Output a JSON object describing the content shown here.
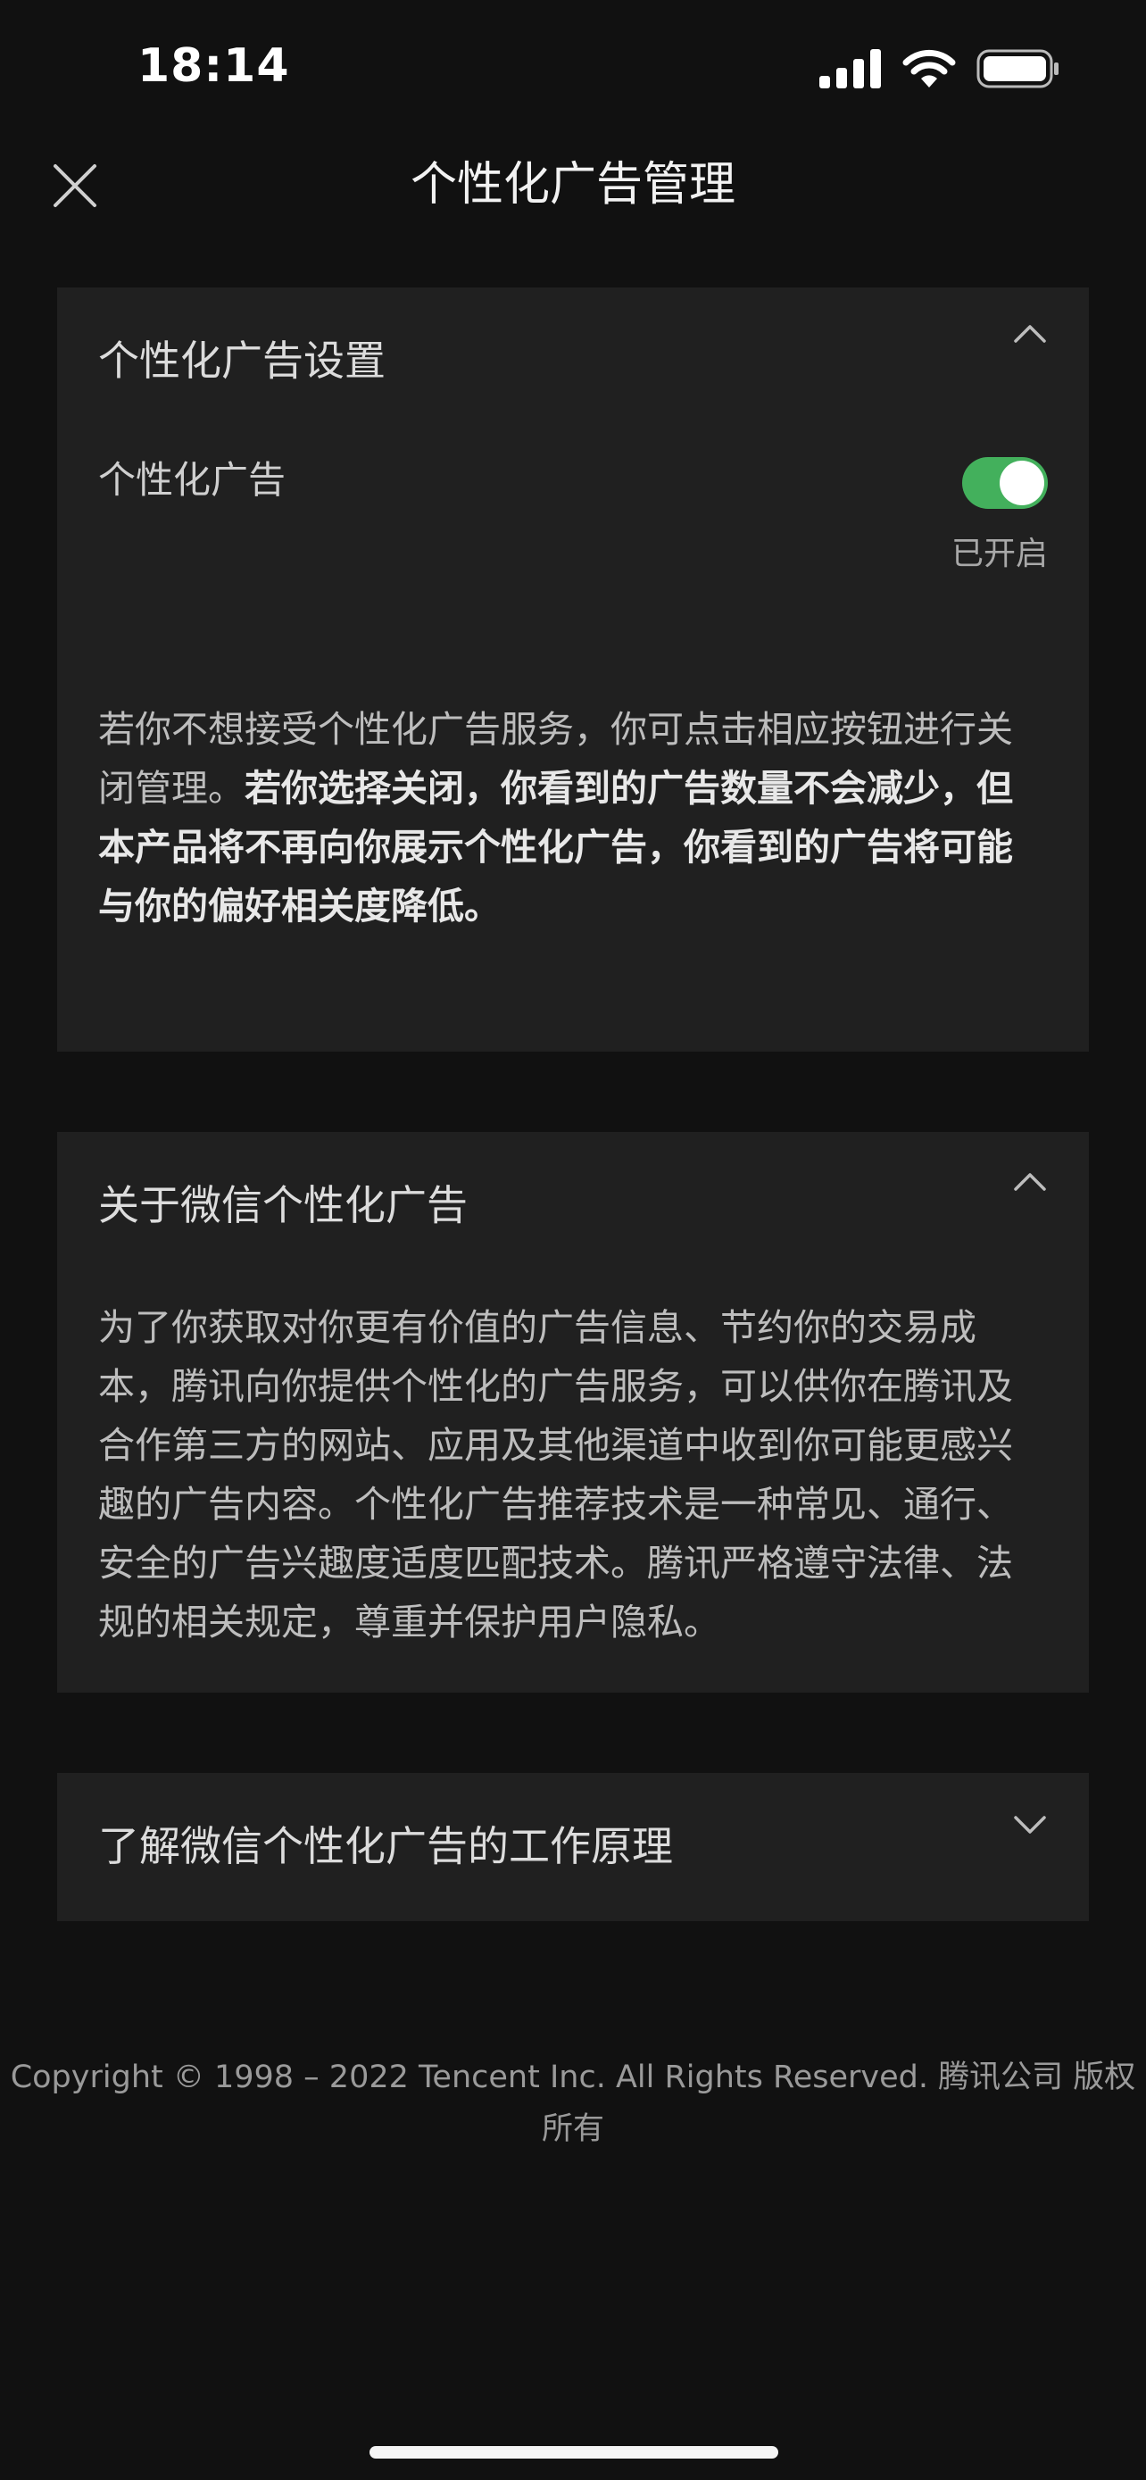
{
  "status_bar": {
    "time": "18:14"
  },
  "nav": {
    "title": "个性化广告管理"
  },
  "settings_card": {
    "title": "个性化广告设置",
    "row_label": "个性化广告",
    "toggle_on": true,
    "toggle_status": "已开启",
    "description_normal": "若你不想接受个性化广告服务，你可点击相应按钮进行关闭管理。",
    "description_bold": "若你选择关闭，你看到的广告数量不会减少，但本产品将不再向你展示个性化广告，你看到的广告将可能与你的偏好相关度降低。"
  },
  "about_card": {
    "title": "关于微信个性化广告",
    "description": "为了你获取对你更有价值的广告信息、节约你的交易成本，腾讯向你提供个性化的广告服务，可以供你在腾讯及合作第三方的网站、应用及其他渠道中收到你可能更感兴趣的广告内容。个性化广告推荐技术是一种常见、通行、安全的广告兴趣度适度匹配技术。腾讯严格遵守法律、法规的相关规定，尊重并保护用户隐私。"
  },
  "how_card": {
    "title": "了解微信个性化广告的工作原理"
  },
  "footer": {
    "copyright": "Copyright © 1998 – 2022 Tencent Inc. All Rights Reserved. 腾讯公司 版权所有"
  },
  "colors": {
    "background": "#111111",
    "card": "#202020",
    "toggle_on": "#43b05c"
  }
}
